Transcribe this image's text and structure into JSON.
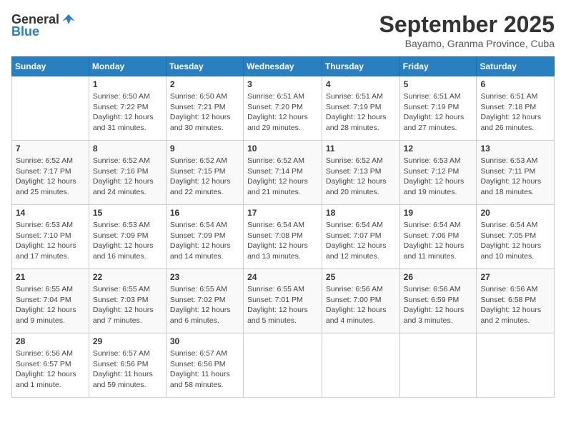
{
  "header": {
    "logo_general": "General",
    "logo_blue": "Blue",
    "month_title": "September 2025",
    "subtitle": "Bayamo, Granma Province, Cuba"
  },
  "weekdays": [
    "Sunday",
    "Monday",
    "Tuesday",
    "Wednesday",
    "Thursday",
    "Friday",
    "Saturday"
  ],
  "weeks": [
    [
      {
        "day": "",
        "info": ""
      },
      {
        "day": "1",
        "info": "Sunrise: 6:50 AM\nSunset: 7:22 PM\nDaylight: 12 hours\nand 31 minutes."
      },
      {
        "day": "2",
        "info": "Sunrise: 6:50 AM\nSunset: 7:21 PM\nDaylight: 12 hours\nand 30 minutes."
      },
      {
        "day": "3",
        "info": "Sunrise: 6:51 AM\nSunset: 7:20 PM\nDaylight: 12 hours\nand 29 minutes."
      },
      {
        "day": "4",
        "info": "Sunrise: 6:51 AM\nSunset: 7:19 PM\nDaylight: 12 hours\nand 28 minutes."
      },
      {
        "day": "5",
        "info": "Sunrise: 6:51 AM\nSunset: 7:19 PM\nDaylight: 12 hours\nand 27 minutes."
      },
      {
        "day": "6",
        "info": "Sunrise: 6:51 AM\nSunset: 7:18 PM\nDaylight: 12 hours\nand 26 minutes."
      }
    ],
    [
      {
        "day": "7",
        "info": "Sunrise: 6:52 AM\nSunset: 7:17 PM\nDaylight: 12 hours\nand 25 minutes."
      },
      {
        "day": "8",
        "info": "Sunrise: 6:52 AM\nSunset: 7:16 PM\nDaylight: 12 hours\nand 24 minutes."
      },
      {
        "day": "9",
        "info": "Sunrise: 6:52 AM\nSunset: 7:15 PM\nDaylight: 12 hours\nand 22 minutes."
      },
      {
        "day": "10",
        "info": "Sunrise: 6:52 AM\nSunset: 7:14 PM\nDaylight: 12 hours\nand 21 minutes."
      },
      {
        "day": "11",
        "info": "Sunrise: 6:52 AM\nSunset: 7:13 PM\nDaylight: 12 hours\nand 20 minutes."
      },
      {
        "day": "12",
        "info": "Sunrise: 6:53 AM\nSunset: 7:12 PM\nDaylight: 12 hours\nand 19 minutes."
      },
      {
        "day": "13",
        "info": "Sunrise: 6:53 AM\nSunset: 7:11 PM\nDaylight: 12 hours\nand 18 minutes."
      }
    ],
    [
      {
        "day": "14",
        "info": "Sunrise: 6:53 AM\nSunset: 7:10 PM\nDaylight: 12 hours\nand 17 minutes."
      },
      {
        "day": "15",
        "info": "Sunrise: 6:53 AM\nSunset: 7:09 PM\nDaylight: 12 hours\nand 16 minutes."
      },
      {
        "day": "16",
        "info": "Sunrise: 6:54 AM\nSunset: 7:09 PM\nDaylight: 12 hours\nand 14 minutes."
      },
      {
        "day": "17",
        "info": "Sunrise: 6:54 AM\nSunset: 7:08 PM\nDaylight: 12 hours\nand 13 minutes."
      },
      {
        "day": "18",
        "info": "Sunrise: 6:54 AM\nSunset: 7:07 PM\nDaylight: 12 hours\nand 12 minutes."
      },
      {
        "day": "19",
        "info": "Sunrise: 6:54 AM\nSunset: 7:06 PM\nDaylight: 12 hours\nand 11 minutes."
      },
      {
        "day": "20",
        "info": "Sunrise: 6:54 AM\nSunset: 7:05 PM\nDaylight: 12 hours\nand 10 minutes."
      }
    ],
    [
      {
        "day": "21",
        "info": "Sunrise: 6:55 AM\nSunset: 7:04 PM\nDaylight: 12 hours\nand 9 minutes."
      },
      {
        "day": "22",
        "info": "Sunrise: 6:55 AM\nSunset: 7:03 PM\nDaylight: 12 hours\nand 7 minutes."
      },
      {
        "day": "23",
        "info": "Sunrise: 6:55 AM\nSunset: 7:02 PM\nDaylight: 12 hours\nand 6 minutes."
      },
      {
        "day": "24",
        "info": "Sunrise: 6:55 AM\nSunset: 7:01 PM\nDaylight: 12 hours\nand 5 minutes."
      },
      {
        "day": "25",
        "info": "Sunrise: 6:56 AM\nSunset: 7:00 PM\nDaylight: 12 hours\nand 4 minutes."
      },
      {
        "day": "26",
        "info": "Sunrise: 6:56 AM\nSunset: 6:59 PM\nDaylight: 12 hours\nand 3 minutes."
      },
      {
        "day": "27",
        "info": "Sunrise: 6:56 AM\nSunset: 6:58 PM\nDaylight: 12 hours\nand 2 minutes."
      }
    ],
    [
      {
        "day": "28",
        "info": "Sunrise: 6:56 AM\nSunset: 6:57 PM\nDaylight: 12 hours\nand 1 minute."
      },
      {
        "day": "29",
        "info": "Sunrise: 6:57 AM\nSunset: 6:56 PM\nDaylight: 11 hours\nand 59 minutes."
      },
      {
        "day": "30",
        "info": "Sunrise: 6:57 AM\nSunset: 6:56 PM\nDaylight: 11 hours\nand 58 minutes."
      },
      {
        "day": "",
        "info": ""
      },
      {
        "day": "",
        "info": ""
      },
      {
        "day": "",
        "info": ""
      },
      {
        "day": "",
        "info": ""
      }
    ]
  ]
}
